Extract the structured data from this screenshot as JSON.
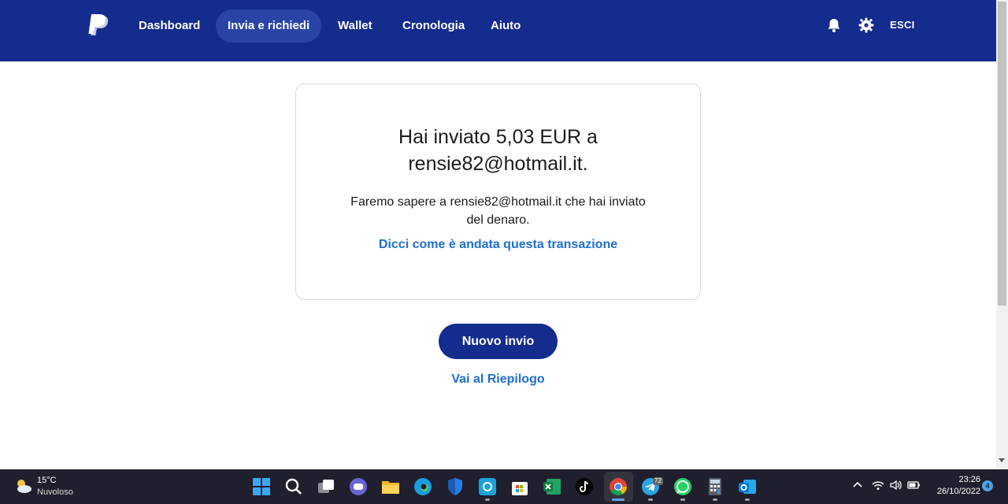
{
  "nav": {
    "items": [
      {
        "label": "Dashboard"
      },
      {
        "label": "Invia e richiedi",
        "active": true
      },
      {
        "label": "Wallet"
      },
      {
        "label": "Cronologia"
      },
      {
        "label": "Aiuto"
      }
    ],
    "logout_label": "ESCI",
    "icons": [
      "paypal-logo",
      "bell-icon",
      "gear-icon"
    ],
    "brand_color": "#142c8e"
  },
  "confirmation": {
    "title_line1": "Hai inviato 5,03 EUR a",
    "title_line2": "rensie82@hotmail.it.",
    "message_line1": "Faremo sapere a rensie82@hotmail.it che hai inviato",
    "message_line2": "del denaro.",
    "feedback_link": "Dicci come è andata questa transazione"
  },
  "actions": {
    "new_send_label": "Nuovo invio",
    "summary_link": "Vai al Riepilogo"
  },
  "taskbar": {
    "weather": {
      "temp": "15°C",
      "desc": "Nuvoloso"
    },
    "telegram_badge": "72",
    "clock": {
      "time": "23:26",
      "date": "26/10/2022"
    },
    "notification_count": "4"
  }
}
